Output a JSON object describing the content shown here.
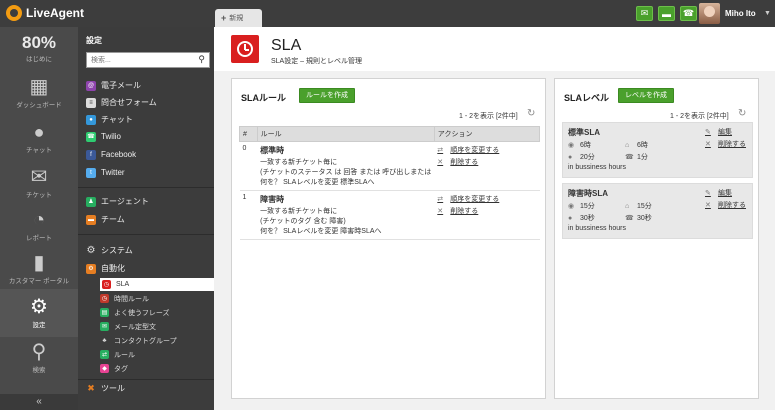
{
  "app": {
    "name": "LiveAgent"
  },
  "tabs": {
    "new_tab": "新規"
  },
  "user": {
    "name": "Miho Ito"
  },
  "leftnav": {
    "percent": "80%",
    "items": [
      {
        "label": "はじめに"
      },
      {
        "label": "ダッシュボード"
      },
      {
        "label": "チャット"
      },
      {
        "label": "チケット"
      },
      {
        "label": "レポート"
      },
      {
        "label": "カスタマー ポータル"
      },
      {
        "label": "設定"
      },
      {
        "label": "検索"
      }
    ],
    "collapse": "«"
  },
  "sidebar": {
    "title": "設定",
    "search_placeholder": "検索...",
    "channels": [
      "電子メール",
      "問合せフォーム",
      "チャット",
      "Twilio",
      "Facebook",
      "Twitter"
    ],
    "people": [
      "エージェント",
      "チーム"
    ],
    "system": "システム",
    "automation": "自動化",
    "automation_items": [
      "SLA",
      "時間ルール",
      "よく使うフレーズ",
      "メール定型文",
      "コンタクトグループ",
      "ルール",
      "タグ"
    ],
    "tools": "ツール"
  },
  "page": {
    "title": "SLA",
    "subtitle": "SLA設定 – 規則とレベル管理"
  },
  "rules_panel": {
    "title": "SLAルール",
    "create_button": "ルールを作成",
    "count": "1 - 2を表示 [2件中]",
    "columns": [
      "#",
      "ルール",
      "アクション"
    ],
    "rows": [
      {
        "num": "0",
        "name": "標準時",
        "lines": [
          "一致する新チケット毎に",
          "(チケットのステータス は 回答 または 呼び出しまたは",
          "何を？ SLAレベルを変更 標準SLAへ"
        ],
        "action_move": "順序を変更する",
        "action_delete": "削除する"
      },
      {
        "num": "1",
        "name": "障害時",
        "lines": [
          "一致する新チケット毎に",
          "(チケットのタグ 含む 障害)",
          "何を？ SLAレベルを変更 障害時SLAへ"
        ],
        "action_move": "順序を変更する",
        "action_delete": "削除する"
      }
    ]
  },
  "levels_panel": {
    "title": "SLAレベル",
    "create_button": "レベルを作成",
    "count": "1 - 2を表示 [2件中]",
    "levels": [
      {
        "name": "標準SLA",
        "v1": "6時",
        "v2": "6時",
        "v3": "20分",
        "v4": "1分",
        "hours": "in bussiness hours",
        "edit": "編集",
        "delete": "削除する"
      },
      {
        "name": "障害時SLA",
        "v1": "15分",
        "v2": "15分",
        "v3": "30秒",
        "v4": "30秒",
        "hours": "in bussiness hours",
        "edit": "編集",
        "delete": "削除する"
      }
    ]
  },
  "colors": {
    "accent_green": "#4aa02c",
    "sla_red": "#d91f1f",
    "topbar": "#3d3d3d"
  }
}
